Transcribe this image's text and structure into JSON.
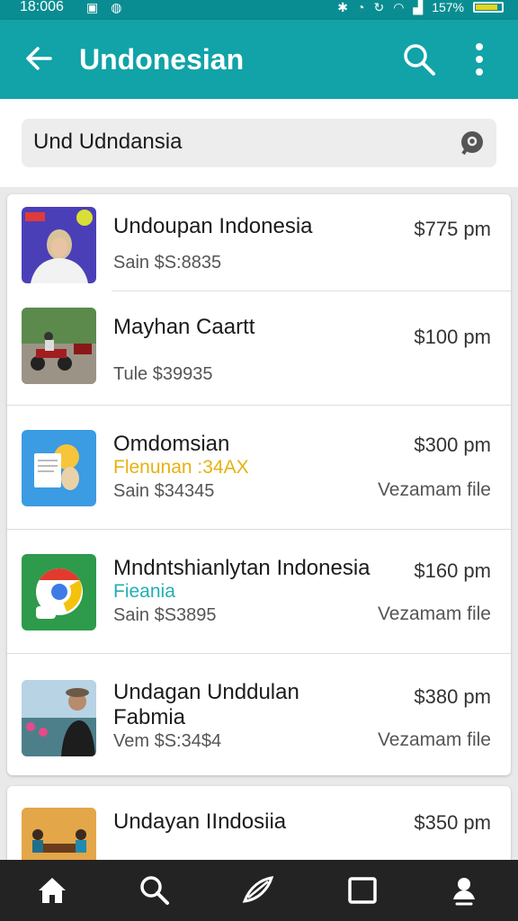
{
  "status_bar": {
    "time": "18:006",
    "battery": "157%",
    "battery_level": 0.8
  },
  "app_bar": {
    "title": "Undonesian"
  },
  "search": {
    "value": "Und Udndansia"
  },
  "results": [
    {
      "title": "Undoupan Indonesia",
      "subtitle": "Sain $S:8835",
      "price": "$775 pm",
      "thumb": "person-portrait"
    },
    {
      "title": "Mayhan Caartt",
      "subtitle": "Tule $39935",
      "price": "$100 pm",
      "thumb": "motorbikes-photo"
    },
    {
      "title": "Omdomsian",
      "tag": "Flenunan :34AX",
      "tag_color": "#e5b20f",
      "subtitle": "Sain $34345",
      "price": "$300 pm",
      "file": "Vezamam file",
      "thumb": "files-app-icon"
    },
    {
      "title": "Mndntshianlytan Indonesia",
      "tag": "Fieania",
      "tag_color": "#22aeb6",
      "subtitle": "Sain $S3895",
      "price": "$160 pm",
      "file": "Vezamam file",
      "thumb": "chrome-icon"
    },
    {
      "title_line1": "Undagan Unddulan",
      "title_line2": "Fabmia",
      "subtitle": "Vem $S:34$4",
      "price": "$380 pm",
      "file": "Vezamam file",
      "thumb": "man-photo"
    },
    {
      "title": "Undayan IIndosiia",
      "price": "$350 pm",
      "thumb": "meeting-photo"
    }
  ],
  "nav": [
    "home",
    "search",
    "explore",
    "recents",
    "profile"
  ],
  "colors": {
    "app_bar": "#11a3a8",
    "status_bar": "#0a8d92",
    "nav_bg": "#232323"
  }
}
